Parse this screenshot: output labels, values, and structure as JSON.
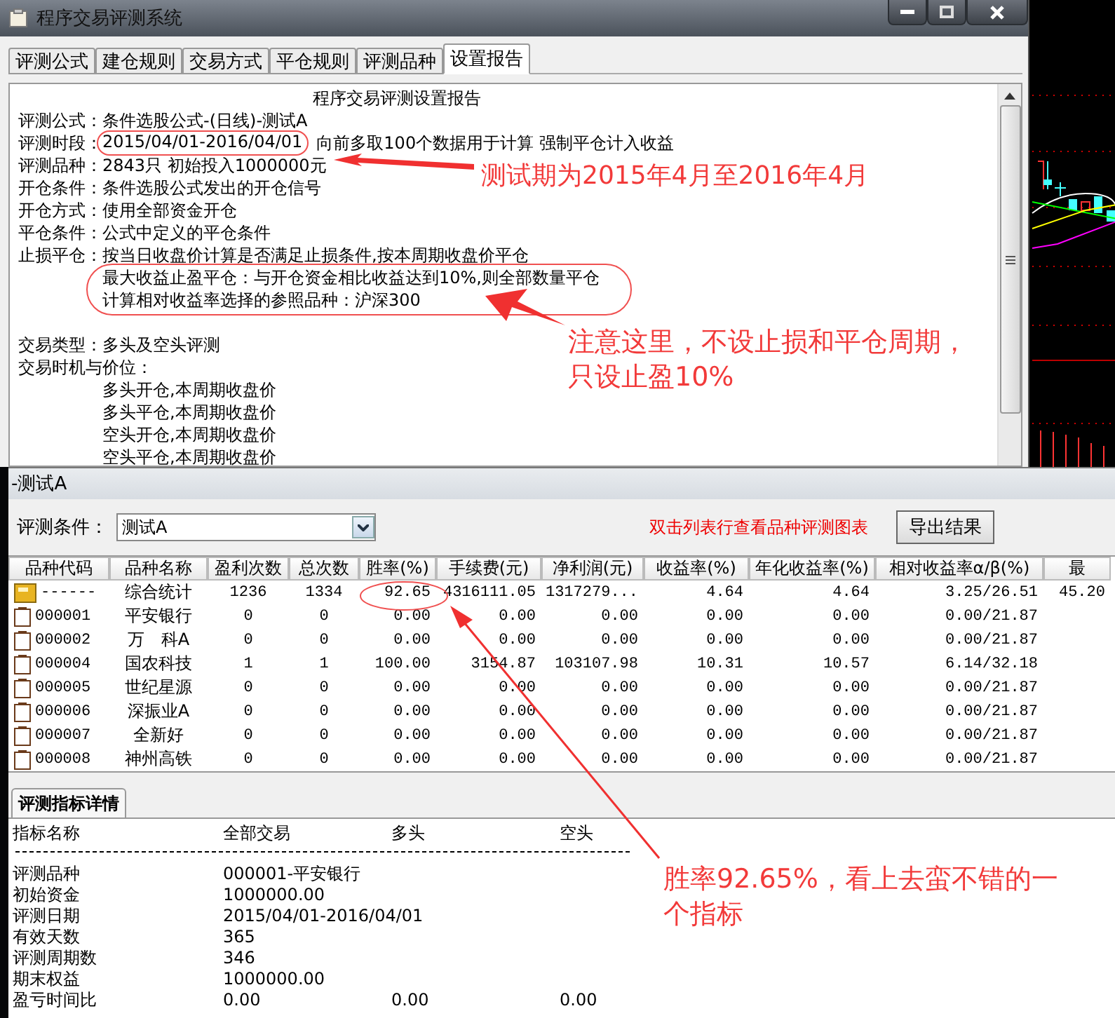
{
  "main_window": {
    "title": "程序交易评测系统",
    "tabs": [
      {
        "label": "评测公式",
        "selected": false
      },
      {
        "label": "建仓规则",
        "selected": false
      },
      {
        "label": "交易方式",
        "selected": false
      },
      {
        "label": "平仓规则",
        "selected": false
      },
      {
        "label": "评测品种",
        "selected": false
      },
      {
        "label": "设置报告",
        "selected": true
      }
    ],
    "report": {
      "title": "程序交易评测设置报告",
      "lines": [
        {
          "kind": "field",
          "label": "评测公式：",
          "value": "条件选股公式-(日线)-测试A"
        },
        {
          "kind": "field",
          "label": "评测时段：",
          "value": "2015/04/01-2016/04/01",
          "circled": true,
          "extra": "向前多取100个数据用于计算 强制平仓计入收益"
        },
        {
          "kind": "field",
          "label": "评测品种：",
          "value": "2843只 初始投入1000000元"
        },
        {
          "kind": "field",
          "label": "开仓条件：",
          "value": "条件选股公式发出的开仓信号"
        },
        {
          "kind": "field",
          "label": "开仓方式：",
          "value": "使用全部资金开仓"
        },
        {
          "kind": "field",
          "label": "平仓条件：",
          "value": "公式中定义的平仓条件"
        },
        {
          "kind": "field",
          "label": "止损平仓：",
          "value": "按当日收盘价计算是否满足止损条件,按本周期收盘价平仓"
        },
        {
          "kind": "indent",
          "value": "最大收益止盈平仓：与开仓资金相比收益达到10%,则全部数量平仓"
        },
        {
          "kind": "indent",
          "value": "计算相对收益率选择的参照品种：沪深300"
        },
        {
          "kind": "blank"
        },
        {
          "kind": "field",
          "label": "交易类型：",
          "value": "多头及空头评测"
        },
        {
          "kind": "field",
          "label": "交易时机与价位："
        },
        {
          "kind": "indent",
          "value": "多头开仓,本周期收盘价"
        },
        {
          "kind": "indent",
          "value": "多头平仓,本周期收盘价"
        },
        {
          "kind": "indent",
          "value": "空头开仓,本周期收盘价"
        },
        {
          "kind": "indent",
          "value": "空头平仓,本周期收盘价"
        }
      ]
    }
  },
  "annotations": [
    {
      "text": "测试期为2015年4月至2016年4月"
    },
    {
      "text": "注意这里，不设止损和平仓周期，只设止盈10%"
    },
    {
      "text": "胜率92.65%，看上去蛮不错的一个指标"
    }
  ],
  "result_window": {
    "title": "-测试A",
    "condition_label": "评测条件：",
    "condition_value": "测试A",
    "hint": "双击列表行查看品种评测图表",
    "export_button": "导出结果",
    "columns": [
      "品种代码",
      "品种名称",
      "盈利次数",
      "总次数",
      "胜率(%)",
      "手续费(元)",
      "净利润(元)",
      "收益率(%)",
      "年化收益率(%)",
      "相对收益率α/β(%)",
      "最"
    ],
    "rows": [
      {
        "kind": "summary",
        "cells": [
          "------",
          "综合统计",
          "1236",
          "1334",
          "92.65",
          "4316111.05",
          "1317279...",
          "4.64",
          "4.64",
          "3.25/26.51",
          "45.20"
        ]
      },
      {
        "kind": "stock",
        "cells": [
          "000001",
          "平安银行",
          "0",
          "0",
          "0.00",
          "0.00",
          "0.00",
          "0.00",
          "0.00",
          "0.00/21.87"
        ]
      },
      {
        "kind": "stock",
        "cells": [
          "000002",
          "万　科A",
          "0",
          "0",
          "0.00",
          "0.00",
          "0.00",
          "0.00",
          "0.00",
          "0.00/21.87"
        ]
      },
      {
        "kind": "stock",
        "cells": [
          "000004",
          "国农科技",
          "1",
          "1",
          "100.00",
          "3154.87",
          "103107.98",
          "10.31",
          "10.57",
          "6.14/32.18"
        ]
      },
      {
        "kind": "stock",
        "cells": [
          "000005",
          "世纪星源",
          "0",
          "0",
          "0.00",
          "0.00",
          "0.00",
          "0.00",
          "0.00",
          "0.00/21.87"
        ]
      },
      {
        "kind": "stock",
        "cells": [
          "000006",
          "深振业A",
          "0",
          "0",
          "0.00",
          "0.00",
          "0.00",
          "0.00",
          "0.00",
          "0.00/21.87"
        ]
      },
      {
        "kind": "stock",
        "cells": [
          "000007",
          "全新好",
          "0",
          "0",
          "0.00",
          "0.00",
          "0.00",
          "0.00",
          "0.00",
          "0.00/21.87"
        ]
      },
      {
        "kind": "stock",
        "cells": [
          "000008",
          "神州高铁",
          "0",
          "0",
          "0.00",
          "0.00",
          "0.00",
          "0.00",
          "0.00",
          "0.00/21.87"
        ]
      }
    ]
  },
  "detail": {
    "tabs": [
      {
        "label": "评测指标详情",
        "selected": true
      }
    ],
    "columns": [
      "指标名称",
      "全部交易",
      "多头",
      "空头"
    ],
    "rows": [
      [
        "评测品种",
        "000001-平安银行"
      ],
      [
        "初始资金",
        "1000000.00"
      ],
      [
        "评测日期",
        "2015/04/01-2016/04/01"
      ],
      [
        "有效天数",
        "365"
      ],
      [
        "评测周期数",
        "346"
      ],
      [
        "期末权益",
        "1000000.00"
      ],
      [
        "盈亏时间比",
        "0.00",
        "0.00",
        "0.00"
      ]
    ]
  }
}
